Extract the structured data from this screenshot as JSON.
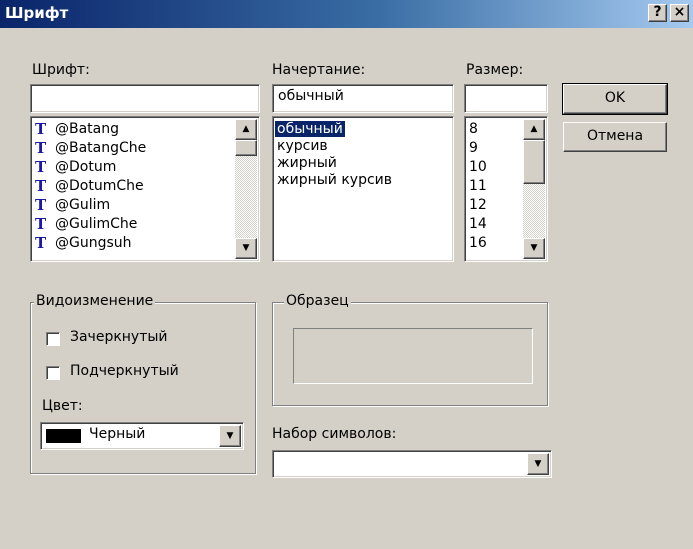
{
  "window": {
    "title": "Шрифт",
    "help_button": "?",
    "close_button": "×"
  },
  "font": {
    "label": "Шрифт:",
    "value": "",
    "items": [
      "@Batang",
      "@BatangChe",
      "@Dotum",
      "@DotumChe",
      "@Gulim",
      "@GulimChe",
      "@Gungsuh"
    ],
    "item_icon": "truetype-font-icon"
  },
  "style": {
    "label": "Начертание:",
    "value": "обычный",
    "items": [
      "обычный",
      "курсив",
      "жирный",
      "жирный курсив"
    ],
    "selected": "обычный"
  },
  "size": {
    "label": "Размер:",
    "value": "",
    "items": [
      "8",
      "9",
      "10",
      "11",
      "12",
      "14",
      "16"
    ]
  },
  "buttons": {
    "ok": "OK",
    "cancel": "Отмена"
  },
  "effects": {
    "title": "Видоизменение",
    "strikeout": {
      "label": "Зачеркнутый",
      "checked": false
    },
    "underline": {
      "label": "Подчеркнутый",
      "checked": false
    },
    "color_label": "Цвет:",
    "color_value": "Черный",
    "color_swatch": "#000000"
  },
  "sample": {
    "title": "Образец"
  },
  "charset": {
    "label": "Набор символов:",
    "value": ""
  },
  "colors": {
    "selection": "#0a246a",
    "face": "#d4d0c8",
    "title_start": "#0a246a",
    "title_end": "#a6caf0"
  }
}
